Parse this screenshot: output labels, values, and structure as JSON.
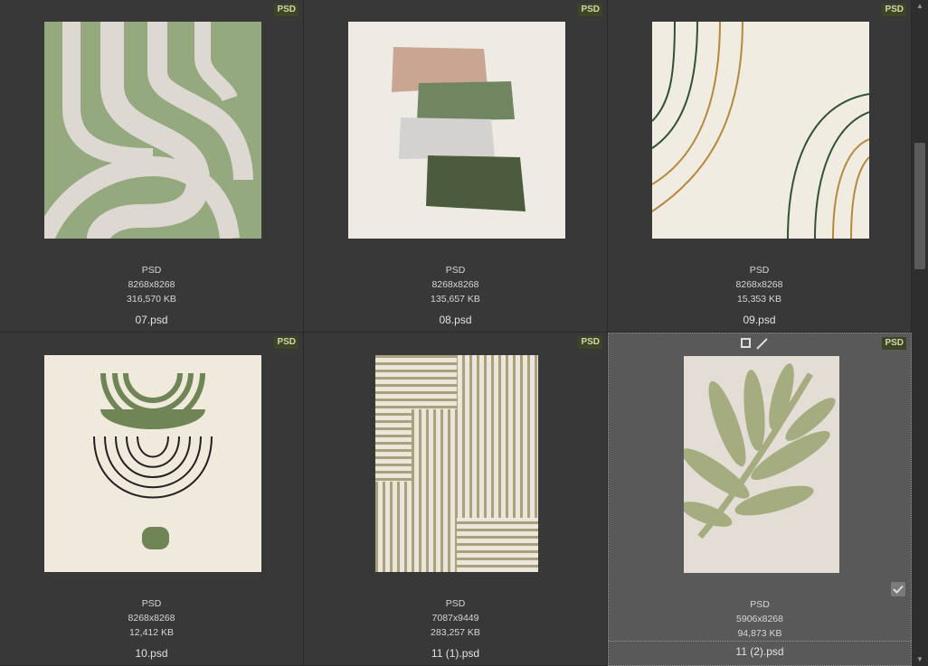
{
  "files": [
    {
      "format": "PSD",
      "dimensions": "8268x8268",
      "size": "316,570 KB",
      "name": "07.psd",
      "badge": "PSD"
    },
    {
      "format": "PSD",
      "dimensions": "8268x8268",
      "size": "135,657 KB",
      "name": "08.psd",
      "badge": "PSD"
    },
    {
      "format": "PSD",
      "dimensions": "8268x8268",
      "size": "15,353 KB",
      "name": "09.psd",
      "badge": "PSD"
    },
    {
      "format": "PSD",
      "dimensions": "8268x8268",
      "size": "12,412 KB",
      "name": "10.psd",
      "badge": "PSD"
    },
    {
      "format": "PSD",
      "dimensions": "7087x9449",
      "size": "283,257 KB",
      "name": "11 (1).psd",
      "badge": "PSD"
    },
    {
      "format": "PSD",
      "dimensions": "5906x8268",
      "size": "94,873 KB",
      "name": "11 (2).psd",
      "badge": "PSD",
      "selected": true
    }
  ],
  "icons": {
    "select_box": "square-outline-icon",
    "edit": "pencil-icon",
    "checkmark": "check-icon",
    "scroll_up": "arrow-up-icon",
    "scroll_down": "arrow-down-icon"
  },
  "colors": {
    "background": "#2b2b2b",
    "cell": "#383838",
    "selected_cell": "#595959",
    "badge_bg": "#3d4527",
    "badge_text": "#cfd7a6"
  }
}
